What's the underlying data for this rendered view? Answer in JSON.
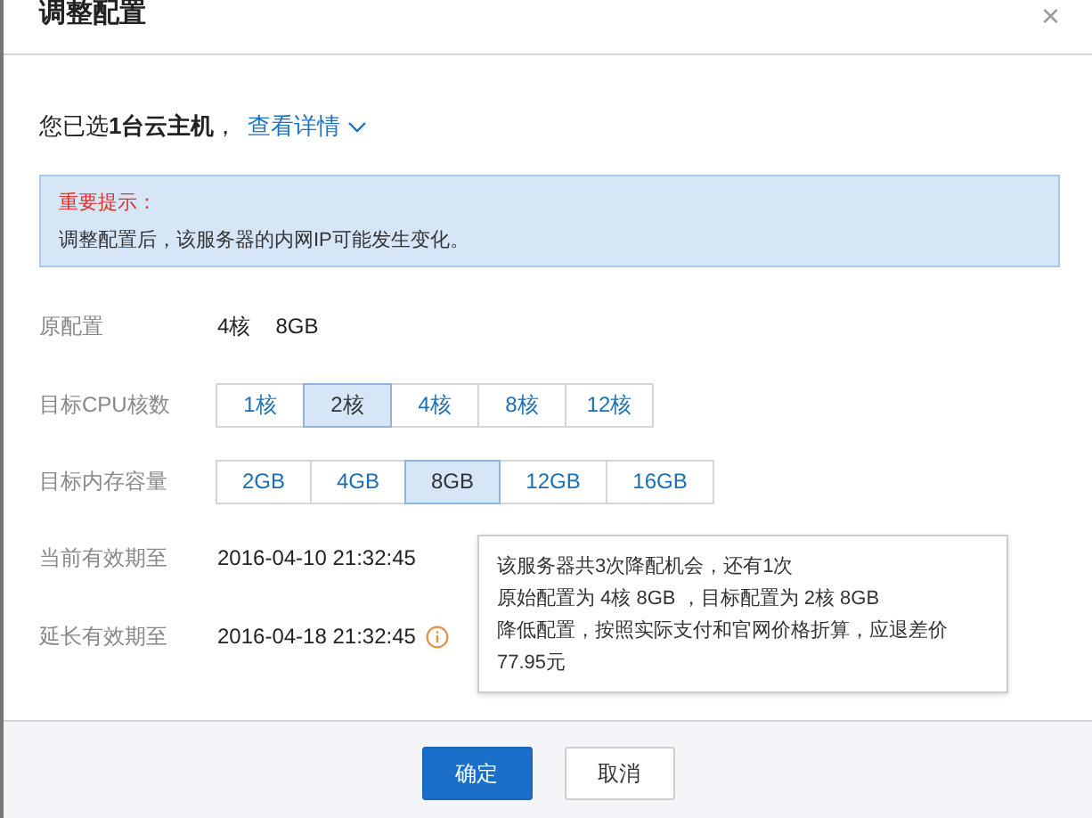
{
  "dialog": {
    "title": "调整配置",
    "close": "×"
  },
  "selection": {
    "text": "您已选**1台云主机**，",
    "link": "查看详情"
  },
  "notice": {
    "heading": "重要提示：",
    "body": "调整配置后，该服务器的内网IP可能发生变化。"
  },
  "original": {
    "label": "原配置",
    "cpu": "4核",
    "memory": "8GB"
  },
  "cpu": {
    "label": "目标CPU核数",
    "options": [
      {
        "label": "1核",
        "selected": false
      },
      {
        "label": "2核",
        "selected": true
      },
      {
        "label": "4核",
        "selected": false
      },
      {
        "label": "8核",
        "selected": false
      },
      {
        "label": "12核",
        "selected": false
      }
    ]
  },
  "memory": {
    "label": "目标内存容量",
    "options": [
      {
        "label": "2GB",
        "selected": false
      },
      {
        "label": "4GB",
        "selected": false
      },
      {
        "label": "8GB",
        "selected": true
      },
      {
        "label": "12GB",
        "selected": false
      },
      {
        "label": "16GB",
        "selected": false
      }
    ]
  },
  "current_expiry": {
    "label": "当前有效期至",
    "value": "2016-04-10 21:32:45"
  },
  "extended_expiry": {
    "label": "延长有效期至",
    "value": "2016-04-18 21:32:45"
  },
  "tooltip": {
    "lines": [
      "该服务器共3次降配机会，还有1次",
      "原始配置为 4核 8GB ，目标配置为 2核 8GB",
      "降低配置，按照实际支付和官网价格折算，应退差价",
      "77.95元"
    ]
  },
  "buttons": {
    "confirm": "确定",
    "cancel": "取消"
  }
}
